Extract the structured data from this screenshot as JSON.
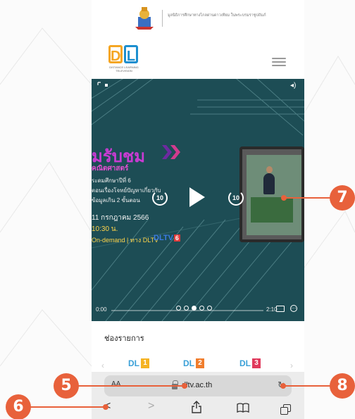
{
  "header": {
    "foundation_text": "มูลนิธิการศึกษาทางไกลผ่านดาวเทียม ในพระบรมราชูปถัมภ์",
    "logo_letters": [
      "D",
      "L"
    ],
    "logo_caption": "DISTANCE LEARNING TELEVISION",
    "seal_icon": "royal-seal-icon",
    "menu_icon": "hamburger-menu-icon"
  },
  "video": {
    "poster_title": "มรับชม",
    "poster_subject": "คณิตศาสตร์",
    "poster_lines": [
      "ระดมศึกษาปีที่ 6",
      "ตอนเรื่องโจทย์ปัญหาเกี่ยวกับ",
      "ข้อมูลเกิน 2 ขั้นตอน"
    ],
    "poster_date": "11 กรกฎาคม 2566",
    "poster_time": "10:30 น.",
    "poster_live": "On-demand | ทาง DLTV",
    "poster_badge": "DLTV",
    "poster_badge_num": "6",
    "skip_back_label": "10",
    "skip_forward_label": "10",
    "time_start": "0:00",
    "time_end": "2:10",
    "progress_fraction": 0.0,
    "page_dots": 5,
    "page_active": 2,
    "accent_magenta": "#c93bd3",
    "accent_yellow": "#ffd44a"
  },
  "channels": {
    "title": "ช่องรายการ",
    "items": [
      {
        "label": "DL",
        "number": "1",
        "color": "#f5b323"
      },
      {
        "label": "DL",
        "number": "2",
        "color": "#f07d2c"
      },
      {
        "label": "DL",
        "number": "3",
        "color": "#e03a5c"
      }
    ]
  },
  "safari": {
    "aa_label": "AA",
    "url": "dltv.ac.th",
    "reload_icon": "reload-icon",
    "back_icon": "chevron-left-icon",
    "forward_icon": "chevron-right-icon",
    "share_icon": "share-icon",
    "bookmarks_icon": "bookmarks-icon",
    "tabs_icon": "tabs-icon",
    "back_glyph": "<",
    "forward_glyph": ">"
  },
  "callouts": [
    {
      "number": "5",
      "color": "#e8613b"
    },
    {
      "number": "6",
      "color": "#e8613b"
    },
    {
      "number": "7",
      "color": "#e8613b"
    },
    {
      "number": "8",
      "color": "#e8613b"
    }
  ]
}
